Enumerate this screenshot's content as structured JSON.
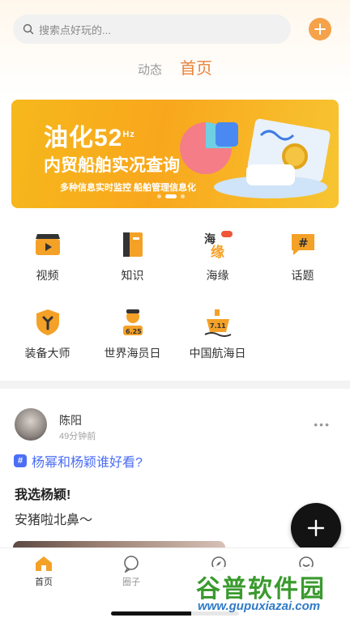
{
  "search": {
    "placeholder": "搜索点好玩的..."
  },
  "tabs": [
    {
      "label": "动态"
    },
    {
      "label": "首页"
    }
  ],
  "banner": {
    "title": "油化52",
    "title_sup": "Hz",
    "subtitle": "内贸船舶实况查询",
    "tagline": "多种信息实时监控 船舶管理信息化"
  },
  "grid": [
    {
      "label": "视频",
      "icon": "video-clapper-icon"
    },
    {
      "label": "知识",
      "icon": "book-icon"
    },
    {
      "label": "海缘",
      "icon": "haiyuan-hot-icon"
    },
    {
      "label": "话题",
      "icon": "hashtag-bubble-icon"
    },
    {
      "label": "装备大师",
      "icon": "wrench-shield-icon"
    },
    {
      "label": "世界海员日",
      "icon": "sailor-625-icon"
    },
    {
      "label": "中国航海日",
      "icon": "ship-711-icon"
    }
  ],
  "post": {
    "user": "陈阳",
    "time": "49分钟前",
    "topic": "杨幂和杨颖谁好看?",
    "title": "我选杨颖!",
    "body": "安猪啦北鼻～"
  },
  "bottom_nav": [
    {
      "label": "首页",
      "active": true
    },
    {
      "label": "圈子",
      "active": false
    },
    {
      "label": "",
      "active": false
    },
    {
      "label": "",
      "active": false
    }
  ],
  "watermark": {
    "line1": "谷普软件园",
    "line2": "www.gupuxiazai.com"
  },
  "colors": {
    "accent": "#e9833a",
    "topic": "#4b6ef5",
    "banner": "#f6b81c"
  }
}
